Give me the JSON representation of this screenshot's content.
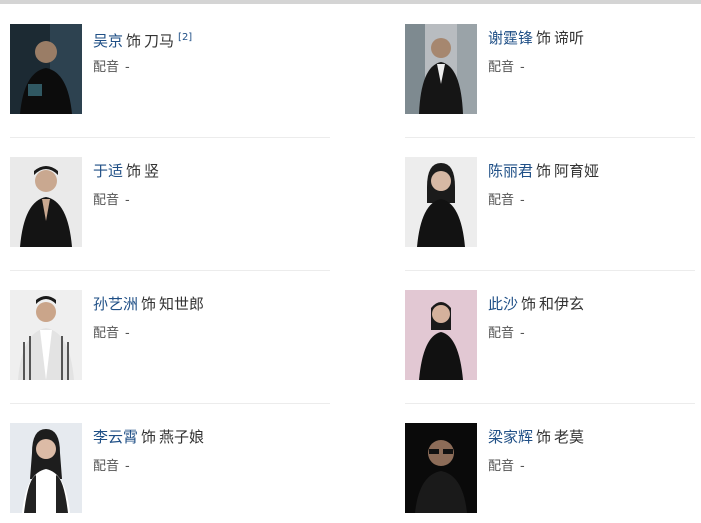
{
  "role_prefix": "饰",
  "dub_label": "配音",
  "dub_value": "-",
  "cast": [
    {
      "actor": "吴京",
      "role": "刀马",
      "ref": "[2]",
      "photo": "dark-studio"
    },
    {
      "actor": "谢霆锋",
      "role": "谛听",
      "ref": "",
      "photo": "street-suit"
    },
    {
      "actor": "于适",
      "role": "竖",
      "ref": "",
      "photo": "white-bg-black"
    },
    {
      "actor": "陈丽君",
      "role": "阿育娅",
      "ref": "",
      "photo": "white-bg-black"
    },
    {
      "actor": "孙艺洲",
      "role": "知世郎",
      "ref": "",
      "photo": "striped-jacket"
    },
    {
      "actor": "此沙",
      "role": "和伊玄",
      "ref": "",
      "photo": "pink-bg-black"
    },
    {
      "actor": "李云霄",
      "role": "燕子娘",
      "ref": "",
      "photo": "light-bg-woman"
    },
    {
      "actor": "梁家辉",
      "role": "老莫",
      "ref": "",
      "photo": "black-bg-glasses"
    }
  ]
}
